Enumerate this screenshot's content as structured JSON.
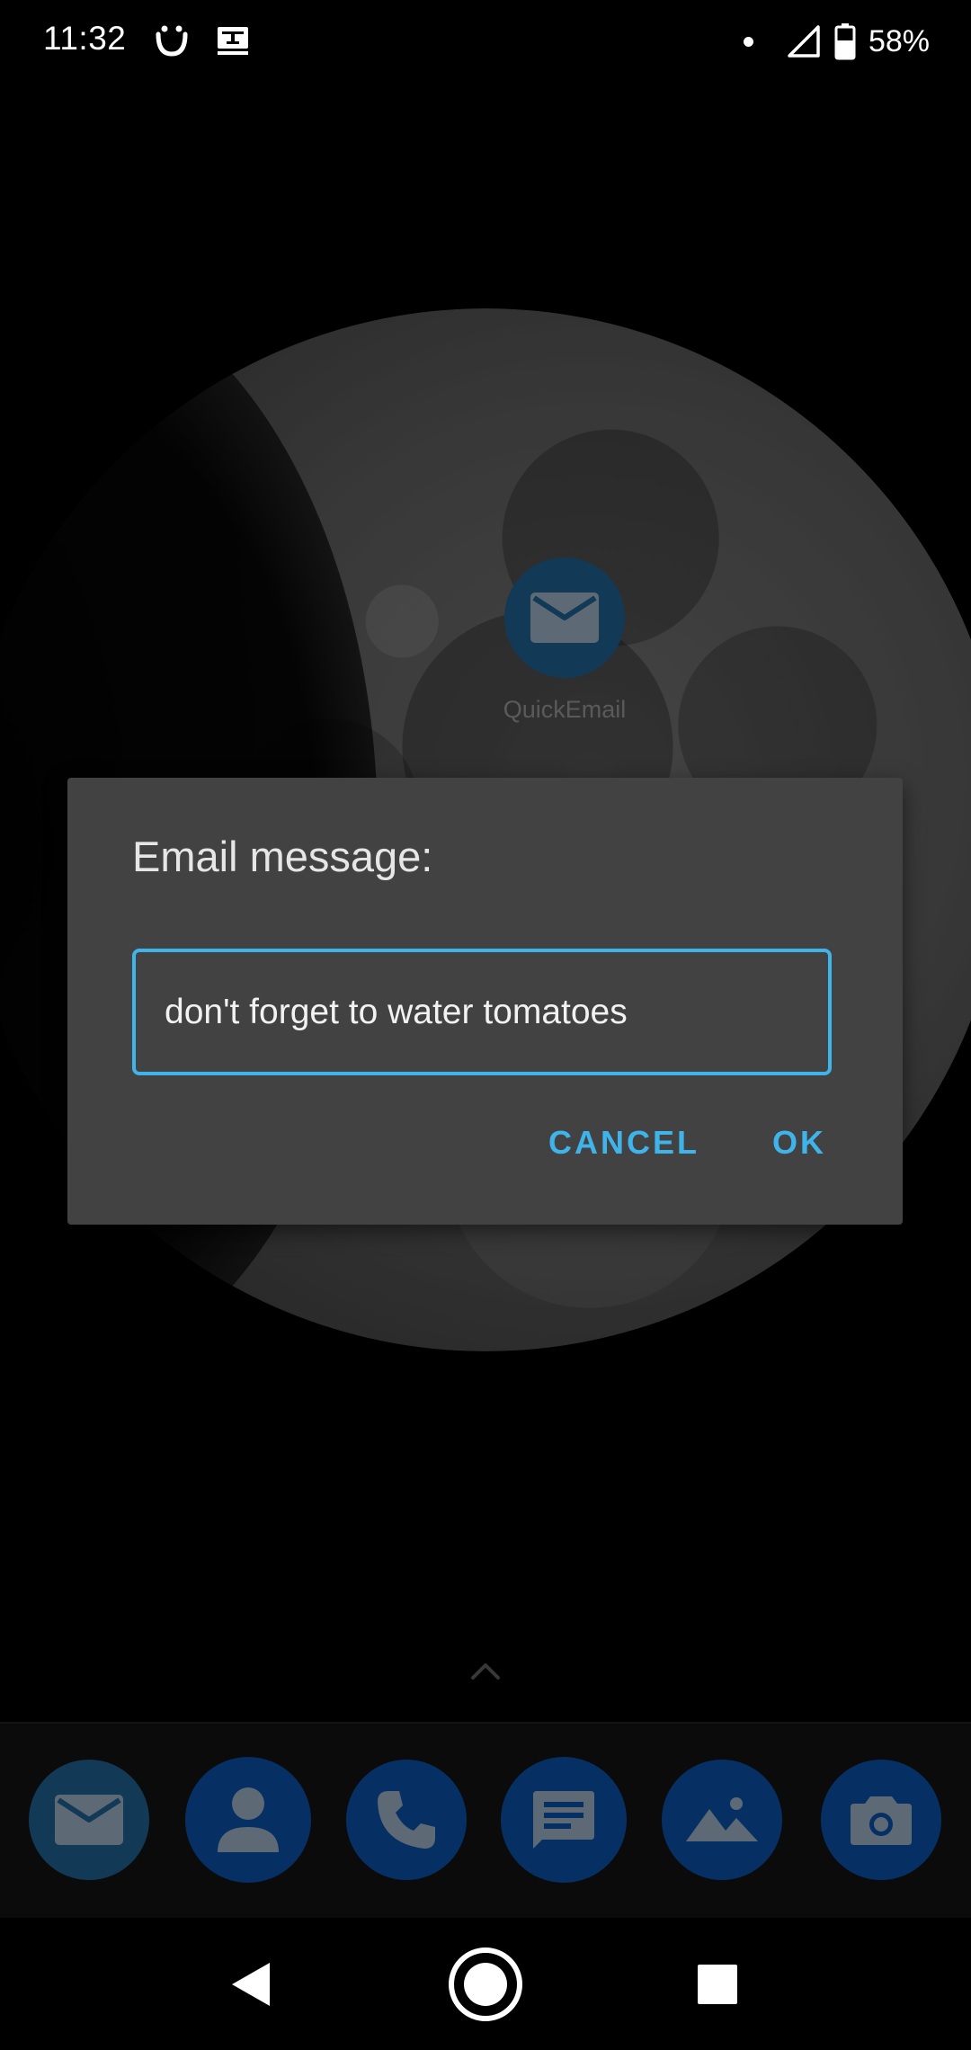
{
  "status_bar": {
    "time": "11:32",
    "battery_percent": "58%",
    "icons": [
      "smiley-icon",
      "keyboard-icon",
      "notification-dot-icon",
      "signal-icon",
      "battery-icon"
    ]
  },
  "home": {
    "shortcut_label": "QuickEmail",
    "shortcut_icon": "mail-icon",
    "accent_color": "#3fb4ea"
  },
  "dialog": {
    "title": "Email message:",
    "input_value": "don't forget to water tomatoes",
    "cancel_label": "CANCEL",
    "ok_label": "OK"
  },
  "dock": {
    "items": [
      {
        "icon": "mail-icon"
      },
      {
        "icon": "contact-icon"
      },
      {
        "icon": "phone-icon"
      },
      {
        "icon": "message-icon"
      },
      {
        "icon": "gallery-icon"
      },
      {
        "icon": "camera-icon"
      }
    ]
  },
  "navbar": {
    "buttons": [
      "back-icon",
      "home-icon",
      "recents-icon"
    ]
  }
}
